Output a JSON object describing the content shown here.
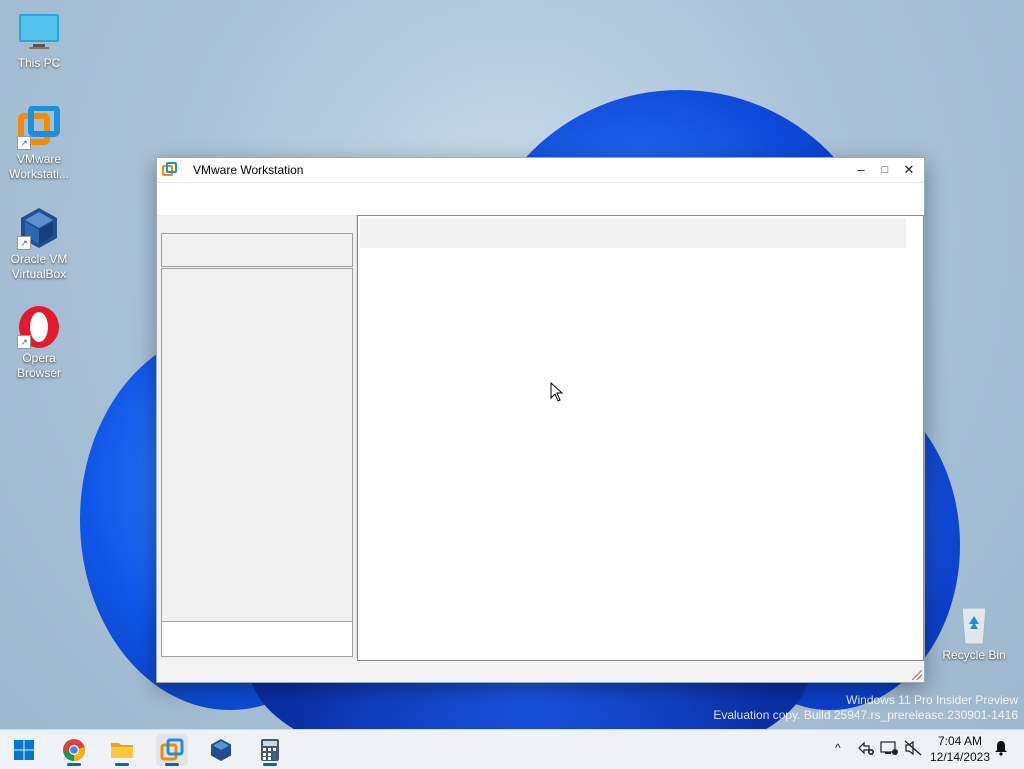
{
  "desktop": {
    "icons": [
      {
        "label": "This PC",
        "icon": "this-pc-icon"
      },
      {
        "label": "VMware Workstati...",
        "icon": "vmware-icon"
      },
      {
        "label": "Oracle VM VirtualBox",
        "icon": "virtualbox-icon"
      },
      {
        "label": "Opera Browser",
        "icon": "opera-icon"
      },
      {
        "label": "Recycle Bin",
        "icon": "recycle-bin-icon"
      }
    ],
    "watermark": {
      "line1": "Windows 11 Pro Insider Preview",
      "line2": "Evaluation copy. Build 25947.rs_prerelease.230901-1416"
    }
  },
  "window": {
    "title": "VMware Workstation",
    "controls": {
      "minimize": "–",
      "maximize": "□",
      "close": "✕"
    }
  },
  "taskbar": {
    "apps": [
      "start-icon",
      "chrome-icon",
      "file-explorer-icon",
      "vmware-icon",
      "virtualbox-icon",
      "calculator-icon"
    ],
    "tray": {
      "chevron": "^"
    },
    "clock": {
      "time": "7:04 AM",
      "date": "12/14/2023"
    }
  },
  "colors": {
    "accent": "#0067c0",
    "vmware_orange": "#f38b00",
    "vmware_blue": "#1d8fe0",
    "opera_red": "#e3192d"
  }
}
